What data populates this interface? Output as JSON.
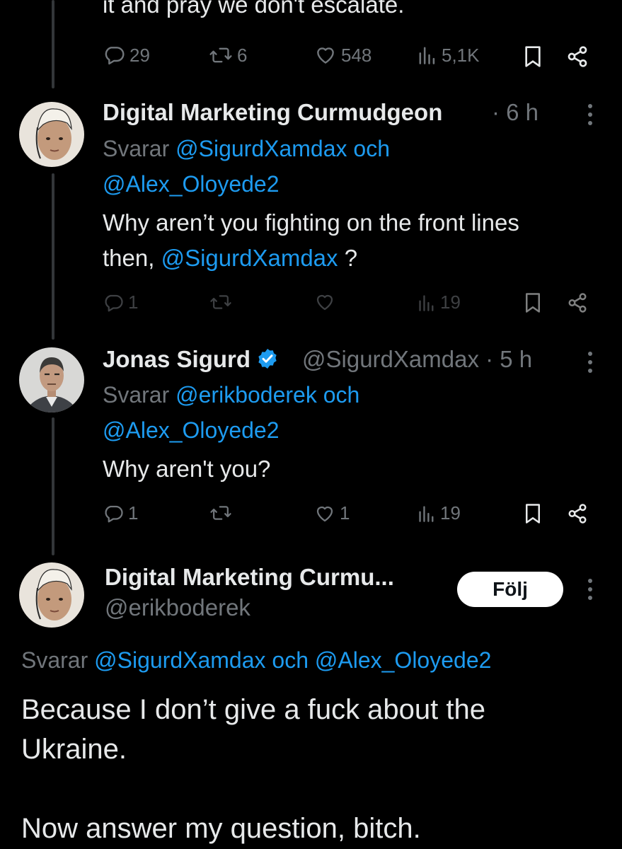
{
  "tweet0": {
    "text_tail": "it and pray we don't escalate.",
    "stats": {
      "replies": "29",
      "reposts": "6",
      "likes": "548",
      "views": "5,1K"
    }
  },
  "tweet1": {
    "name": "Digital Marketing Curmudgeon",
    "time": "· 6 h",
    "replying_prefix": "Svarar",
    "replying_line1": "@SigurdXamdax och",
    "replying_line2": "@Alex_Oloyede2",
    "text_line1": "Why aren’t you fighting on the front lines",
    "text_line2_start": "then, ",
    "text_mention": "@SigurdXamdax",
    "text_line2_end": " ?",
    "stats": {
      "replies": "1",
      "reposts": "",
      "likes": "",
      "views": "19"
    }
  },
  "tweet2": {
    "name": "Jonas Sigurd",
    "handle": "@SigurdXamdax",
    "time": "· 5 h",
    "replying_prefix": "Svarar",
    "replying_line1": "@erikboderek och",
    "replying_line2": "@Alex_Oloyede2",
    "text": "Why aren't you?",
    "stats": {
      "replies": "1",
      "reposts": "",
      "likes": "1",
      "views": "19"
    }
  },
  "tweet3": {
    "name": "Digital Marketing Curmu...",
    "handle": "@erikboderek",
    "follow_label": "Följ",
    "replying_prefix": "Svarar",
    "replying_mentions": "@SigurdXamdax och @Alex_Oloyede2",
    "text_line1": "Because I don’t give a fuck about the",
    "text_line2": "Ukraine.",
    "text_line3": "Now answer my question, bitch."
  },
  "colors": {
    "background": "#000000",
    "text": "#e7e9ea",
    "muted": "#71767b",
    "link": "#1d9bf0"
  },
  "icons": [
    "reply-icon",
    "repost-icon",
    "like-icon",
    "views-icon",
    "bookmark-icon",
    "share-icon",
    "more-icon",
    "verified-icon"
  ]
}
